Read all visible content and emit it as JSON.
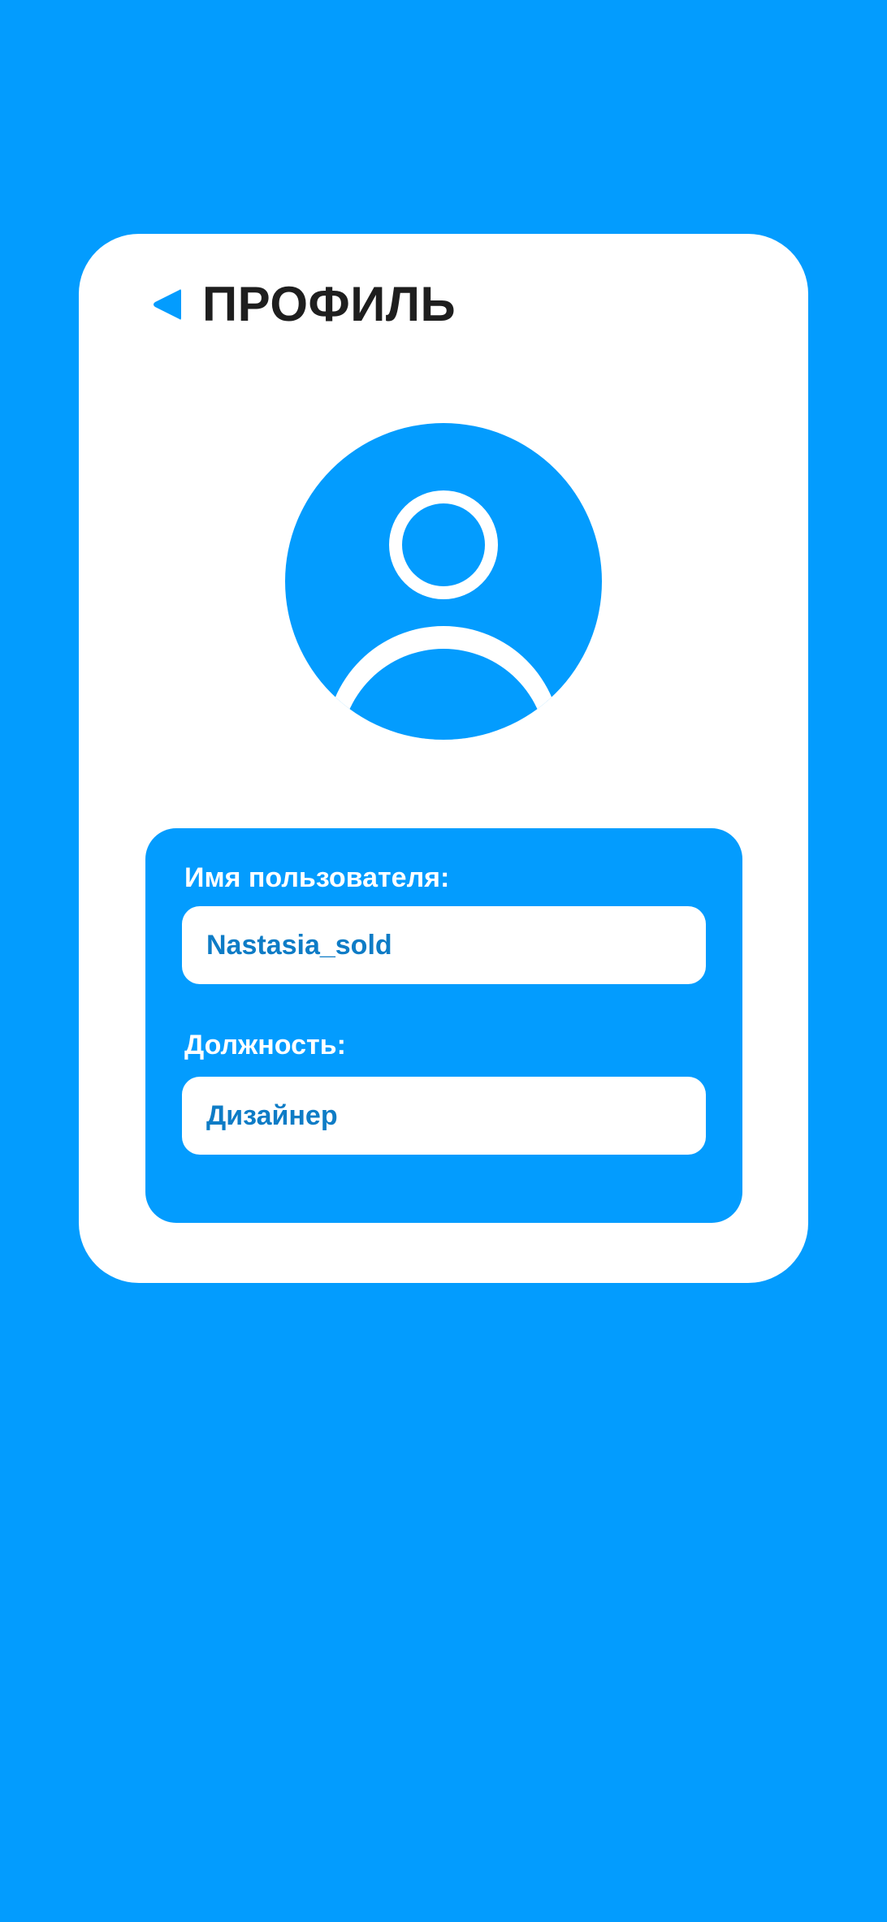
{
  "colors": {
    "background": "#039CFE",
    "card": "#FFFFFF",
    "title_text": "#1E1E1E",
    "value_text": "#0E7CC6"
  },
  "header": {
    "back_icon": "back-triangle-icon",
    "title": "ПРОФИЛЬ"
  },
  "avatar": {
    "icon": "user-avatar-icon"
  },
  "fields": [
    {
      "label": "Имя пользователя:",
      "value": "Nastasia_sold"
    },
    {
      "label": "Должность:",
      "value": "Дизайнер"
    }
  ]
}
